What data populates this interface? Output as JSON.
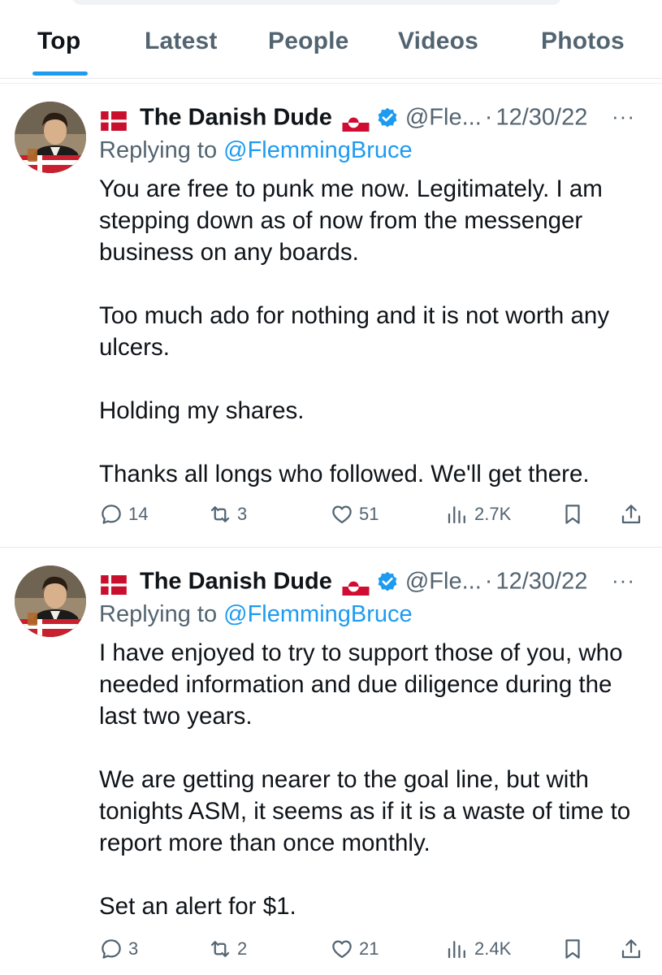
{
  "tabs": [
    {
      "label": "Top",
      "active": true
    },
    {
      "label": "Latest",
      "active": false
    },
    {
      "label": "People",
      "active": false
    },
    {
      "label": "Videos",
      "active": false
    },
    {
      "label": "Photos",
      "active": false
    }
  ],
  "colors": {
    "accent": "#1d9bf0",
    "text": "#0f1419",
    "muted": "#536471",
    "divider": "#e6e9ea"
  },
  "tweets": [
    {
      "name": "The Danish Dude",
      "handle": "@Fle...",
      "separator": "·",
      "date": "12/30/22",
      "more": "···",
      "replying_prefix": "Replying to",
      "replying_to": "@FlemmingBruce",
      "paragraphs": [
        "You are free to punk me now. Legitimately. I am stepping down as of now from the messenger business on any boards.",
        "Too much ado for nothing and it is not worth any ulcers.",
        "Holding my shares.",
        "Thanks all longs who followed. We'll get there."
      ],
      "replies": "14",
      "retweets": "3",
      "likes": "51",
      "views": "2.7K",
      "icons": [
        "danish-flag-icon",
        "greenland-flag-icon",
        "verified-badge-icon",
        "reply-icon",
        "retweet-icon",
        "like-icon",
        "views-icon",
        "bookmark-icon",
        "share-icon"
      ]
    },
    {
      "name": "The Danish Dude",
      "handle": "@Fle...",
      "separator": "·",
      "date": "12/30/22",
      "more": "···",
      "replying_prefix": "Replying to",
      "replying_to": "@FlemmingBruce",
      "paragraphs": [
        "I have enjoyed to try to support those of you, who needed information and due diligence during the last two years.",
        "We are getting nearer to the goal line, but with tonights ASM, it seems as if it is a waste of time to report more than once monthly.",
        "Set an alert for $1."
      ],
      "replies": "3",
      "retweets": "2",
      "likes": "21",
      "views": "2.4K",
      "icons": [
        "danish-flag-icon",
        "greenland-flag-icon",
        "verified-badge-icon",
        "reply-icon",
        "retweet-icon",
        "like-icon",
        "views-icon",
        "bookmark-icon",
        "share-icon"
      ]
    }
  ]
}
